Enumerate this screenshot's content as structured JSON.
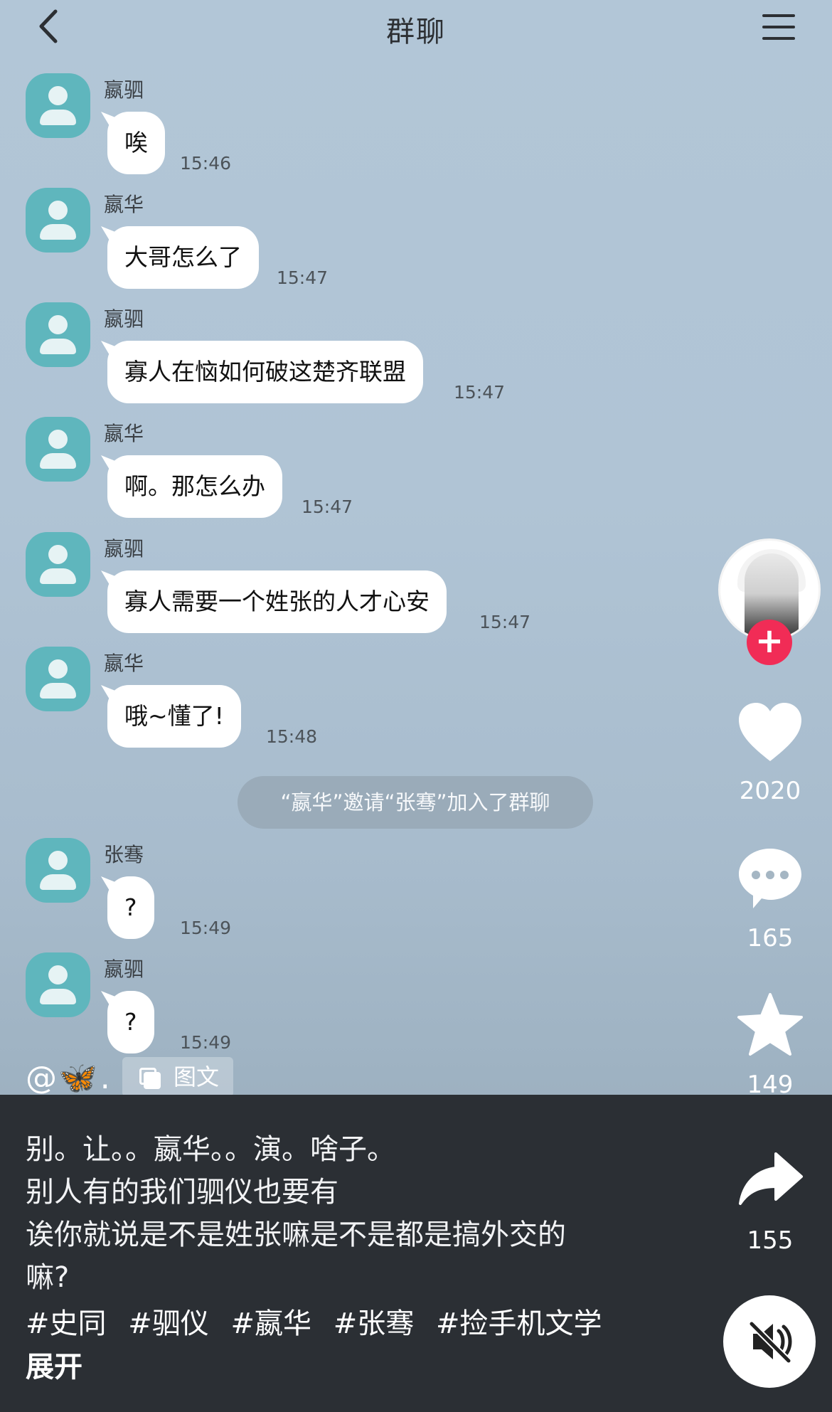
{
  "header": {
    "title": "群聊"
  },
  "messages": [
    {
      "sender": "嬴驷",
      "text": "唉",
      "time": "15:46"
    },
    {
      "sender": "嬴华",
      "text": "大哥怎么了",
      "time": "15:47"
    },
    {
      "sender": "嬴驷",
      "text": "寡人在恼如何破这楚齐联盟",
      "time": "15:47"
    },
    {
      "sender": "嬴华",
      "text": "啊。那怎么办",
      "time": "15:47"
    },
    {
      "sender": "嬴驷",
      "text": "寡人需要一个姓张的人才心安",
      "time": "15:47"
    },
    {
      "sender": "嬴华",
      "text": "哦~懂了!",
      "time": "15:48"
    },
    {
      "sender": "张骞",
      "text": "?",
      "time": "15:49"
    },
    {
      "sender": "嬴驷",
      "text": "?",
      "time": "15:49"
    }
  ],
  "system_message": "“嬴华”邀请“张骞”加入了群聊",
  "author": {
    "prefix": "@",
    "emoji": "🦋",
    "suffix": "."
  },
  "post_type_badge": "图文",
  "caption": {
    "lines": [
      "别。让。。嬴华。。演。啥子。",
      "别人有的我们驷仪也要有",
      "诶你就说是不是姓张嘛是不是都是搞外交的",
      "嘛?"
    ],
    "hashtags": [
      "#史同",
      "#驷仪",
      "#嬴华",
      "#张骞",
      "#捡手机文学"
    ],
    "expand_label": "展开"
  },
  "actions": {
    "likes": "2020",
    "comments": "165",
    "favorites": "149",
    "shares": "155"
  },
  "icons": {
    "back": "chevron-left-icon",
    "menu": "hamburger-menu-icon",
    "like": "heart-icon",
    "comment": "comment-bubble-icon",
    "favorite": "star-icon",
    "share": "share-arrow-icon",
    "mute": "speaker-muted-icon",
    "follow": "plus-icon"
  },
  "colors": {
    "accent_follow": "#f12c56",
    "avatar": "#5fb6bd",
    "caption_bg": "#2b2f34"
  }
}
